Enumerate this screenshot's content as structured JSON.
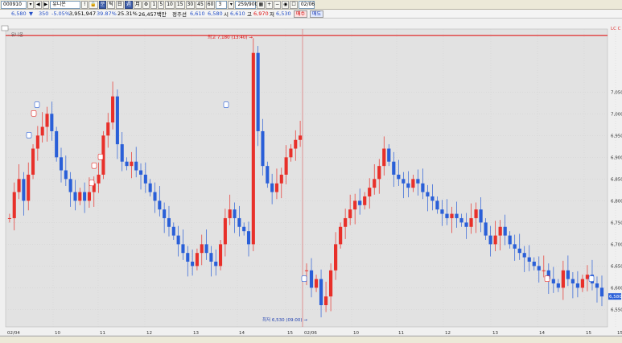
{
  "toolbar": {
    "code": "000910",
    "name": "유니온",
    "interval": "3",
    "count": "259/900",
    "date": "02/06",
    "buttons": [
      "분",
      "틱",
      "日",
      "週",
      "月",
      "1",
      "5",
      "10",
      "15",
      "30",
      "45",
      "60"
    ]
  },
  "info": {
    "price": "6,580",
    "arrow": "▼",
    "change": "350",
    "change_pct": "-5.05%",
    "volume": "3,951,947",
    "vol_ratio": "39.87%",
    "amount": "25.31%",
    "trade_value": "26,457백만",
    "ma_label": "정주선",
    "ma_value": "6,610",
    "open_label": "시",
    "open": "6,610",
    "open2": "6,580",
    "high_label": "고",
    "high": "6,970",
    "low_label": "저",
    "low": "6,530",
    "sell_label": "매수",
    "buy_label": "매도"
  },
  "chart": {
    "panel_label": "유니온",
    "high_annotation": "최고 7,180 (13:40)",
    "low_annotation": "최저 6,530 (09:00)",
    "corner_label": "LC C",
    "current_price": "6,580",
    "y_ticks": [
      "7,050",
      "7,000",
      "6,950",
      "6,900",
      "6,850",
      "6,800",
      "6,750",
      "6,700",
      "6,650",
      "6,600",
      "6,550"
    ],
    "x_labels": [
      {
        "label": "02/04",
        "day": 0
      },
      {
        "label": "10",
        "day": 1
      },
      {
        "label": "11",
        "day": 2
      },
      {
        "label": "12",
        "day": 3
      },
      {
        "label": "13",
        "day": 4
      },
      {
        "label": "14",
        "day": 5
      },
      {
        "label": "15",
        "day": 6
      },
      {
        "label": "02/06",
        "day": 7
      },
      {
        "label": "10",
        "day": 8
      },
      {
        "label": "11",
        "day": 9
      },
      {
        "label": "12",
        "day": 10
      },
      {
        "label": "13",
        "day": 11
      },
      {
        "label": "14",
        "day": 12
      },
      {
        "label": "15",
        "day": 13
      },
      {
        "label": "15:30",
        "day": 14
      }
    ],
    "colors": {
      "up": "#e8302a",
      "down": "#2a5fd8",
      "grid": "#d8d8d8",
      "bg": "#e2e2e2",
      "line_red": "#e00000"
    }
  },
  "chart_data": {
    "type": "candlestick",
    "title": "",
    "y_range": [
      6530,
      7180
    ],
    "high": 7180,
    "low": 6530,
    "close": 6580,
    "series": [
      {
        "segment": "02/04",
        "closes": [
          6760,
          6820,
          6850,
          6800,
          6860,
          6920,
          6950,
          6970,
          7000,
          6960,
          6900,
          6870,
          6850,
          6820,
          6800,
          6820,
          6800,
          6820,
          6840,
          6860,
          6950,
          6980,
          7040,
          6930,
          6890,
          6880,
          6890,
          6870,
          6860,
          6840,
          6820,
          6800,
          6780,
          6760,
          6740,
          6720,
          6700,
          6680,
          6660,
          6650,
          6680,
          6700,
          6680,
          6660,
          6650,
          6700,
          6760,
          6780,
          6760,
          6740,
          6730,
          6700,
          7140,
          6960,
          6880,
          6840,
          6820,
          6840,
          6860,
          6900,
          6920,
          6940,
          6950
        ]
      },
      {
        "segment": "02/06",
        "closes": [
          6640,
          6600,
          6620,
          6560,
          6580,
          6640,
          6700,
          6740,
          6760,
          6780,
          6800,
          6790,
          6810,
          6830,
          6850,
          6880,
          6920,
          6890,
          6860,
          6850,
          6840,
          6830,
          6850,
          6840,
          6820,
          6810,
          6800,
          6780,
          6770,
          6760,
          6770,
          6760,
          6750,
          6740,
          6760,
          6780,
          6750,
          6720,
          6700,
          6720,
          6740,
          6720,
          6700,
          6690,
          6680,
          6670,
          6660,
          6650,
          6640,
          6640,
          6620,
          6610,
          6600,
          6640,
          6620,
          6610,
          6600,
          6620,
          6630,
          6610,
          6600,
          6580
        ]
      }
    ]
  }
}
